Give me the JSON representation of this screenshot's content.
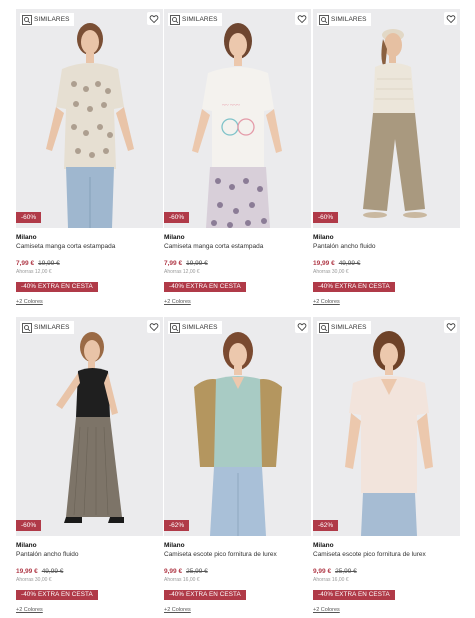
{
  "common": {
    "similares_label": "SIMILARES",
    "extra_label": "-40% EXTRA EN CESTA",
    "colors_label": "+2 Colores",
    "accent_color": "#b03a48"
  },
  "products": [
    {
      "discount": "-60%",
      "brand": "Milano",
      "name": "Camiseta manga corta estampada",
      "price": "7,99 €",
      "old_price": "19,99 €",
      "before": "Ahorras 12,00 €"
    },
    {
      "discount": "-60%",
      "brand": "Milano",
      "name": "Camiseta manga corta estampada",
      "price": "7,99 €",
      "old_price": "19,99 €",
      "before": "Ahorras 12,00 €"
    },
    {
      "discount": "-60%",
      "brand": "Milano",
      "name": "Pantalón ancho fluido",
      "price": "19,99 €",
      "old_price": "49,99 €",
      "before": "Ahorras 30,00 €"
    },
    {
      "discount": "-60%",
      "brand": "Milano",
      "name": "Pantalón ancho fluido",
      "price": "19,99 €",
      "old_price": "49,99 €",
      "before": "Ahorras 30,00 €"
    },
    {
      "discount": "-62%",
      "brand": "Milano",
      "name": "Camiseta escote pico fornitura de lurex",
      "price": "9,99 €",
      "old_price": "25,99 €",
      "before": "Ahorras 16,00 €"
    },
    {
      "discount": "-62%",
      "brand": "Milano",
      "name": "Camiseta escote pico fornitura de lurex",
      "price": "9,99 €",
      "old_price": "25,99 €",
      "before": "Ahorras 16,00 €"
    }
  ]
}
